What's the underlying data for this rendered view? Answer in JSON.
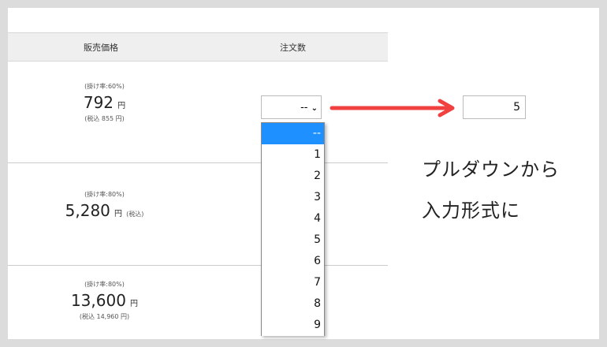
{
  "table": {
    "headers": [
      "販売価格",
      "注文数"
    ],
    "rows": [
      {
        "rate": "(掛け率:60%)",
        "price": "792",
        "yen": "円",
        "tax": "(税込 855 円)"
      },
      {
        "rate": "(掛け率:80%)",
        "price": "5,280",
        "yen": "円",
        "tax_inline": "(税込)"
      },
      {
        "rate": "(掛け率:80%)",
        "price": "13,600",
        "yen": "円",
        "tax": "(税込 14,960 円)"
      }
    ]
  },
  "select": {
    "value": "--",
    "options": [
      "--",
      "1",
      "2",
      "3",
      "4",
      "5",
      "6",
      "7",
      "8",
      "9"
    ]
  },
  "input": {
    "value": "5"
  },
  "note": {
    "line1": "プルダウンから",
    "line2": "入力形式に"
  },
  "colors": {
    "arrow": "#f04040",
    "highlight": "#1e90ff"
  }
}
